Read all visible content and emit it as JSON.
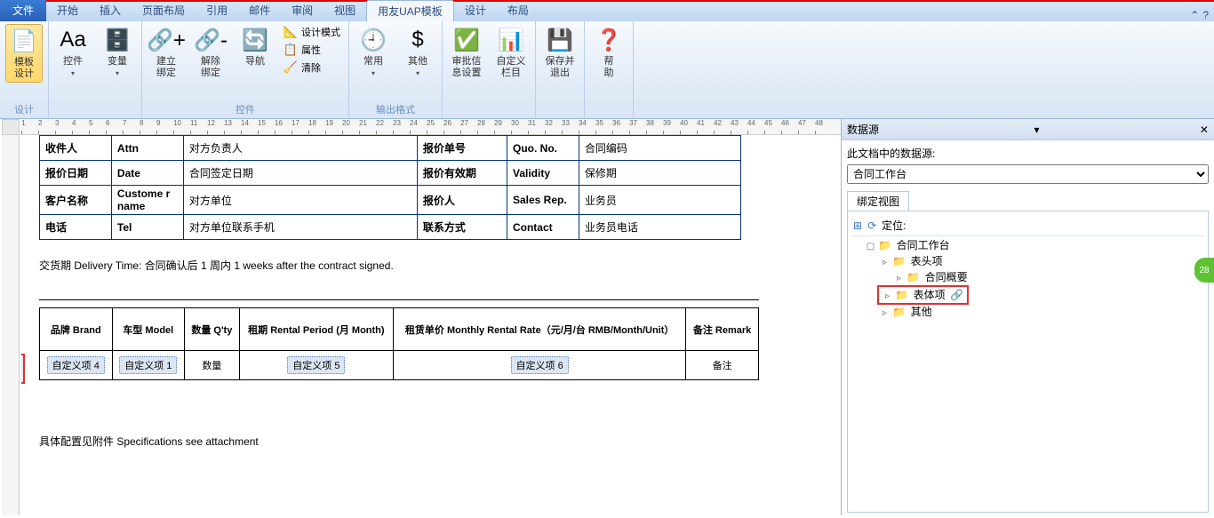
{
  "tabs": {
    "file": "文件",
    "items": [
      "开始",
      "插入",
      "页面布局",
      "引用",
      "邮件",
      "审阅",
      "视图",
      "用友UAP模板",
      "设计",
      "布局"
    ],
    "active_index": 7
  },
  "ribbon": {
    "groups": [
      {
        "label": "设计",
        "buttons": [
          {
            "name": "template-design",
            "text": "模板\n设计",
            "icon": "📄",
            "selected": true
          }
        ]
      },
      {
        "label": "",
        "buttons": [
          {
            "name": "font",
            "text": "控件",
            "icon": "Aa",
            "drop": true
          },
          {
            "name": "variable",
            "text": "变量",
            "icon": "🗄️",
            "drop": true
          }
        ]
      },
      {
        "label": "控件",
        "buttons": [
          {
            "name": "create-bind",
            "text": "建立\n绑定",
            "icon": "🔗+"
          },
          {
            "name": "remove-bind",
            "text": "解除\n绑定",
            "icon": "🔗-"
          },
          {
            "name": "nav",
            "text": "导航",
            "icon": "🔄"
          }
        ],
        "extras": [
          {
            "name": "design-mode",
            "text": "设计模式",
            "icon": "📐"
          },
          {
            "name": "properties",
            "text": "属性",
            "icon": "📋"
          },
          {
            "name": "clear",
            "text": "清除",
            "icon": "🧹"
          }
        ]
      },
      {
        "label": "输出格式",
        "buttons": [
          {
            "name": "common",
            "text": "常用",
            "icon": "🕘",
            "drop": true
          },
          {
            "name": "other",
            "text": "其他",
            "icon": "$",
            "drop": true
          }
        ]
      },
      {
        "label": "",
        "buttons": [
          {
            "name": "approve-info",
            "text": "审批信\n息设置",
            "icon": "✅"
          },
          {
            "name": "custom-column",
            "text": "自定义\n栏目",
            "icon": "📊"
          }
        ]
      },
      {
        "label": "",
        "buttons": [
          {
            "name": "save-exit",
            "text": "保存并\n退出",
            "icon": "💾"
          }
        ]
      },
      {
        "label": "",
        "buttons": [
          {
            "name": "help",
            "text": "帮\n助",
            "icon": "❓"
          }
        ]
      }
    ]
  },
  "document": {
    "info_rows": [
      [
        "收件人",
        "Attn",
        "对方负责人",
        "报价单号",
        "Quo. No.",
        "合同编码"
      ],
      [
        "报价日期",
        "Date",
        "合同签定日期",
        "报价有效期",
        "Validity",
        "保修期"
      ],
      [
        "客户名称",
        "Custome r name",
        "对方单位",
        "报价人",
        "Sales Rep.",
        "业务员"
      ],
      [
        "电话",
        "Tel",
        "对方单位联系手机",
        "联系方式",
        "Contact",
        "业务员电话"
      ]
    ],
    "delivery_text": "交货期 Delivery Time: 合同确认后  1  周内     1     weeks after the contract signed.",
    "body_headers": [
      "品牌 Brand",
      "车型 Model",
      "数量 Q'ty",
      "租期 Rental Period (月 Month)",
      "租赁单价 Monthly Rental Rate（元/月/台 RMB/Month/Unit）",
      "备注 Remark"
    ],
    "body_cells": [
      "自定义项 4",
      "自定义项 1",
      "数量",
      "自定义项 5",
      "自定义项 6",
      "备注"
    ],
    "footer_text": "具体配置见附件  Specifications see attachment"
  },
  "side": {
    "title": "数据源",
    "subtitle": "此文档中的数据源:",
    "select_value": "合同工作台",
    "subtab": "绑定视图",
    "locate_label": "定位:",
    "tree": {
      "root": "合同工作台",
      "children": [
        {
          "label": "表头项",
          "children": [
            {
              "label": "合同概要"
            }
          ]
        },
        {
          "label": "表体项",
          "highlighted": true,
          "link": true
        },
        {
          "label": "其他"
        }
      ]
    }
  },
  "badge_text": "28"
}
